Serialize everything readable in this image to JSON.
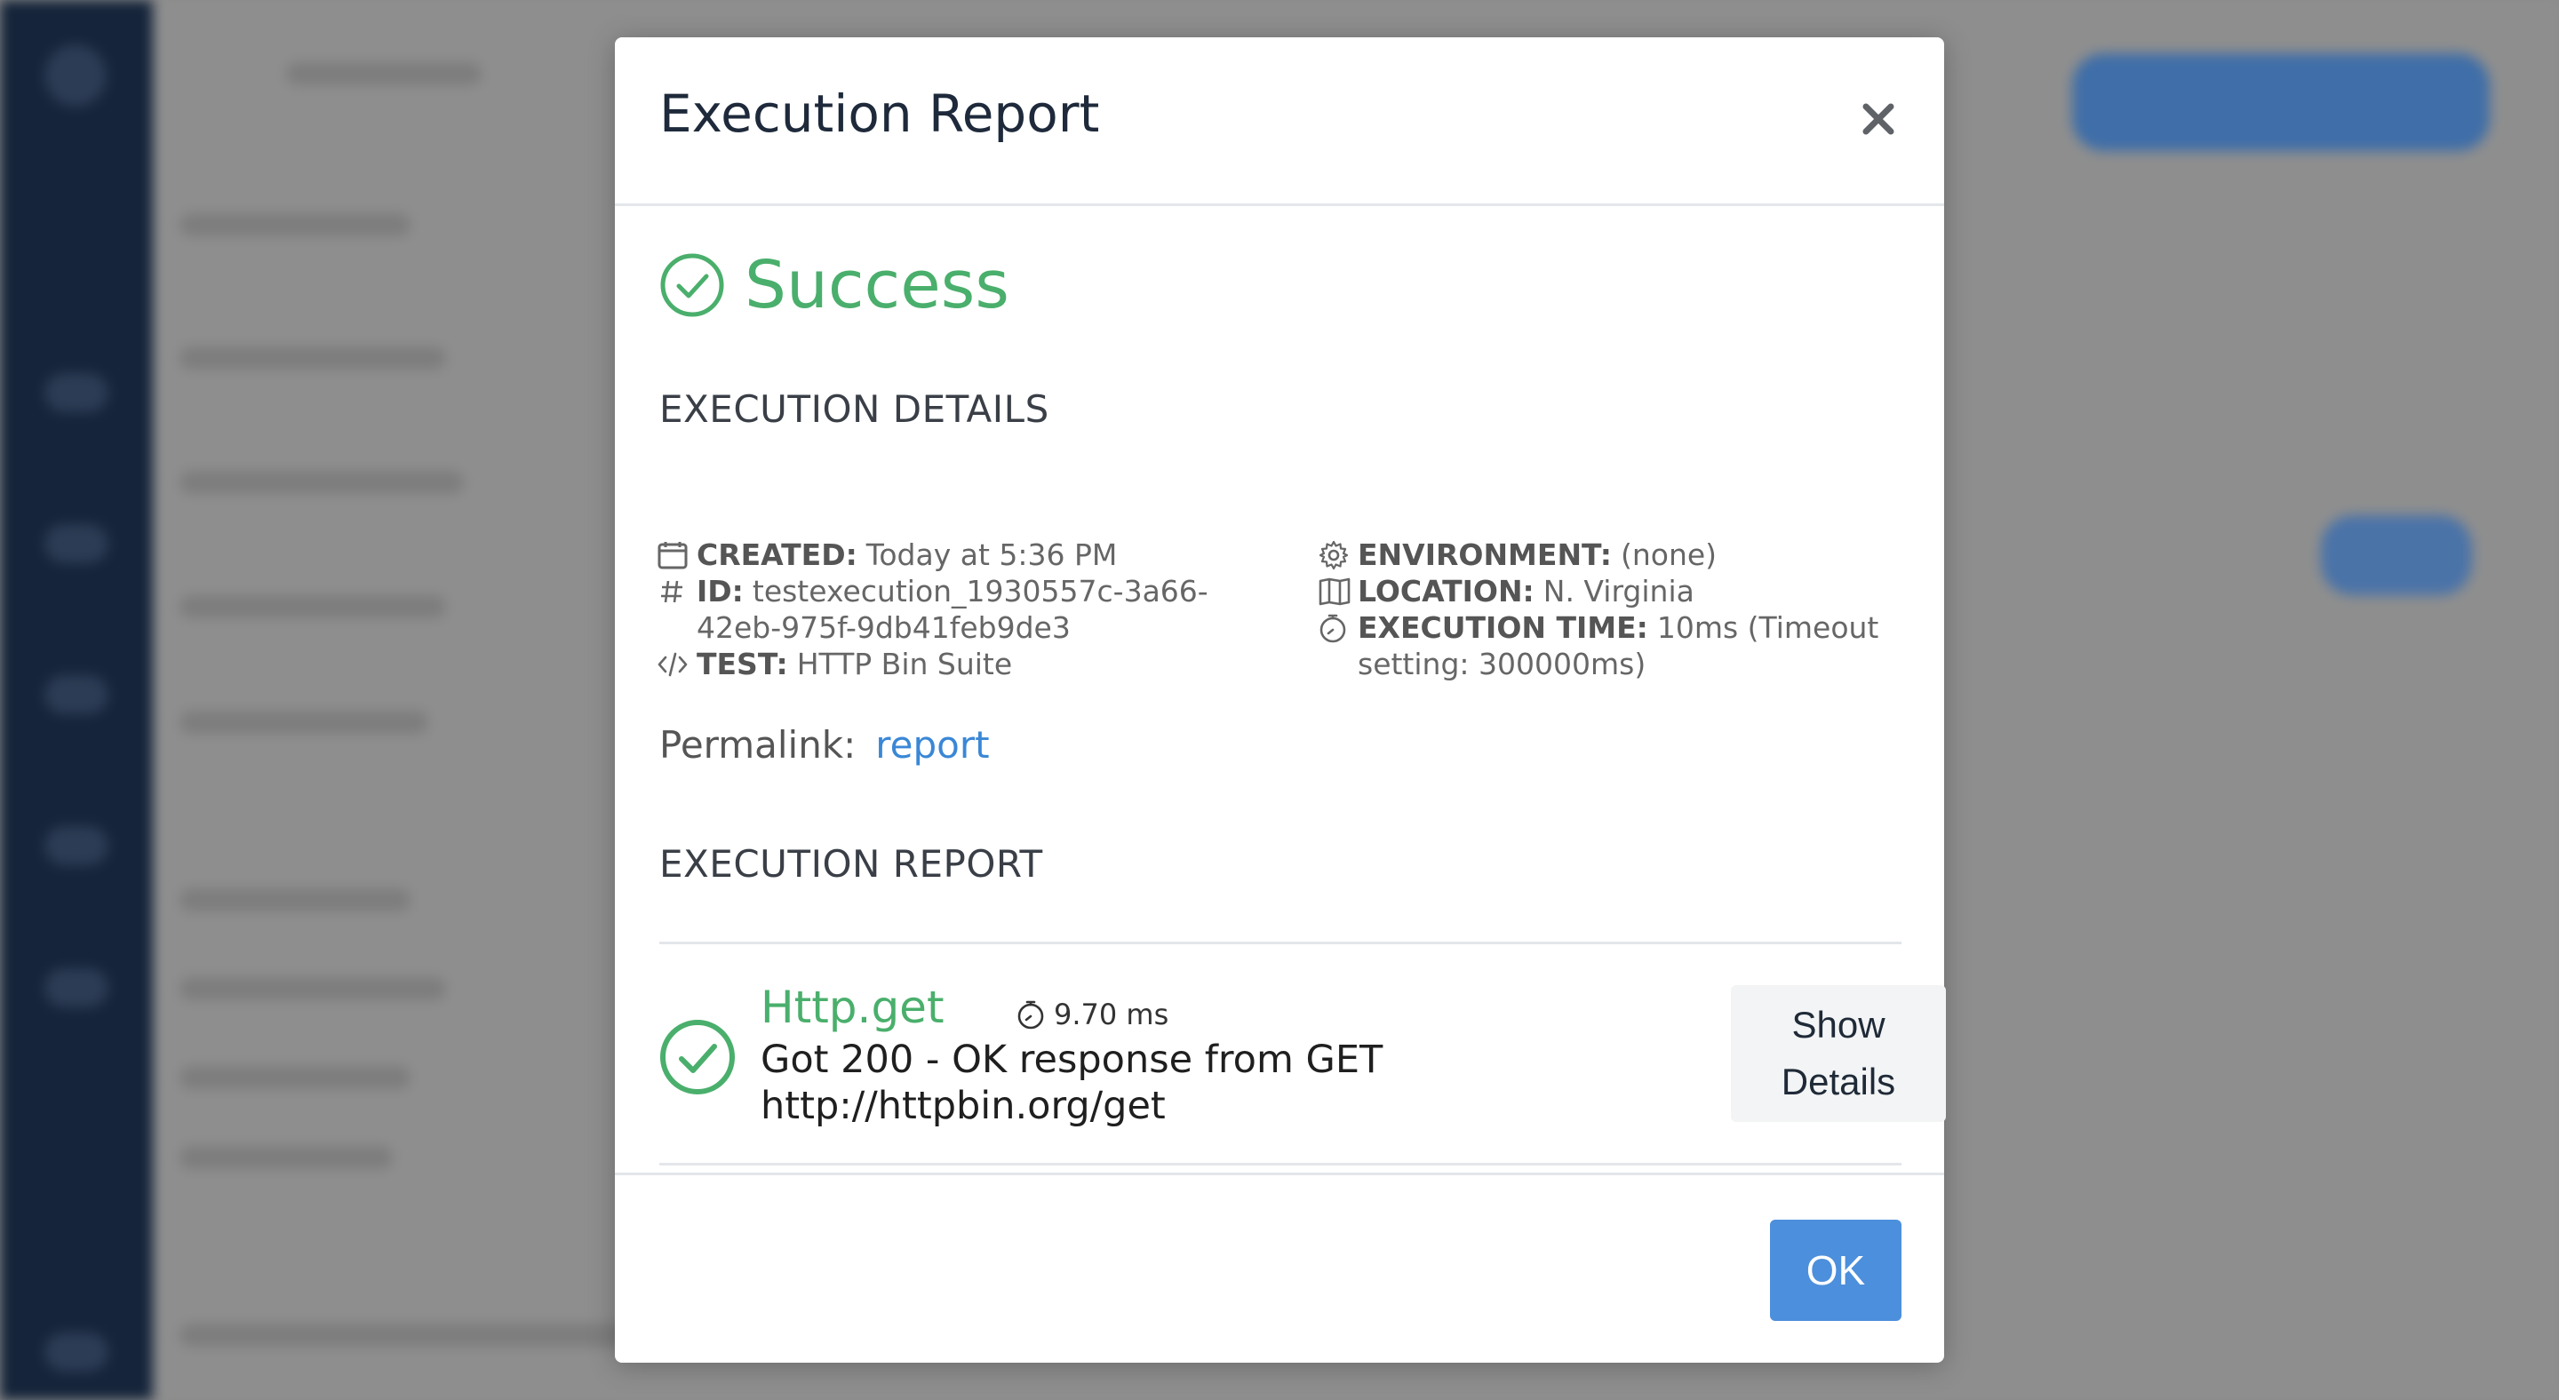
{
  "modal": {
    "title": "Execution Report",
    "close_icon": "close-icon",
    "status": {
      "label": "Success",
      "icon": "check-circle-icon",
      "color": "#4aaf6c"
    },
    "details_heading": "EXECUTION DETAILS",
    "details_left": [
      {
        "icon": "calendar-icon",
        "key": "CREATED:",
        "value": "Today at 5:36 PM"
      },
      {
        "icon": "hash-icon",
        "key": "ID:",
        "value": "testexecution_1930557c-3a66-42eb-975f-9db41feb9de3"
      },
      {
        "icon": "code-icon",
        "key": "TEST:",
        "value": "HTTP Bin Suite"
      }
    ],
    "details_right": [
      {
        "icon": "gear-icon",
        "key": "ENVIRONMENT:",
        "value": "(none)"
      },
      {
        "icon": "map-icon",
        "key": "LOCATION:",
        "value": "N. Virginia"
      },
      {
        "icon": "stopwatch-icon",
        "key": "EXECUTION TIME:",
        "value": "10ms (Timeout setting: 300000ms)"
      }
    ],
    "permalink": {
      "label": "Permalink:",
      "link_text": "report"
    },
    "report_heading": "EXECUTION REPORT",
    "report_step": {
      "name": "Http.get",
      "duration": "9.70 ms",
      "message": "Got 200 - OK response from GET http://httpbin.org/get",
      "show_details_label": "Show Details"
    },
    "ok_label": "OK"
  }
}
